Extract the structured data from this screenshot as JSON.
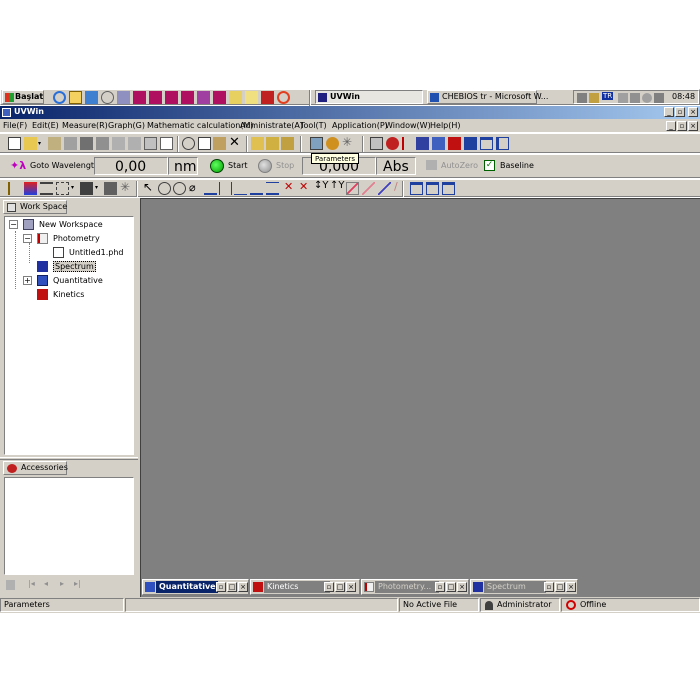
{
  "taskbar": {
    "start_label": "Başlat",
    "tasks": [
      {
        "label": "UVWin",
        "active": true
      },
      {
        "label": "CHEBIOS tr - Microsoft W...",
        "active": false
      }
    ],
    "tray": {
      "language": "TR",
      "clock": "08:48"
    }
  },
  "window": {
    "title": "UVWin",
    "menu": [
      "File(F)",
      "Edit(E)",
      "Measure(R)",
      "Graph(G)",
      "Mathematic calculation(M)",
      "Administrate(A)",
      "Tool(T)",
      "Application(P)",
      "Window(W)",
      "Help(H)"
    ]
  },
  "tooltip": "Parameters",
  "control_bar": {
    "goto_label": "Goto Wavelength",
    "wavelength_value": "0,00",
    "wavelength_unit": "nm",
    "start_label": "Start",
    "stop_label": "Stop",
    "abs_value": "0,000",
    "abs_unit": "Abs",
    "autozero_label": "AutoZero",
    "baseline_label": "Baseline"
  },
  "workspace": {
    "tab_label": "Work Space",
    "tree": [
      {
        "label": "New Workspace",
        "level": 0,
        "expander": "-"
      },
      {
        "label": "Photometry",
        "level": 1,
        "expander": "-"
      },
      {
        "label": "Untitled1.phd",
        "level": 2,
        "expander": ""
      },
      {
        "label": "Spectrum",
        "level": 1,
        "expander": "",
        "selected": true
      },
      {
        "label": "Quantitative",
        "level": 1,
        "expander": "+"
      },
      {
        "label": "Kinetics",
        "level": 1,
        "expander": ""
      }
    ]
  },
  "accessories": {
    "tab_label": "Accessories"
  },
  "mdi_tabs": [
    {
      "label": "Quantitative...",
      "active": true
    },
    {
      "label": "Kinetics",
      "active": false
    },
    {
      "label": "Photometry...",
      "active": false
    },
    {
      "label": "Spectrum",
      "active": false
    }
  ],
  "status_bar": {
    "message": "Parameters",
    "file": "No Active File",
    "user": "Administrator",
    "connection": "Offline"
  },
  "colors": {
    "face": "#d4d0c8",
    "client_area": "#808080",
    "title_active": "#0a246a",
    "title_inactive": "#808080",
    "start_green": "#00b000",
    "offline_red": "#d00000"
  }
}
